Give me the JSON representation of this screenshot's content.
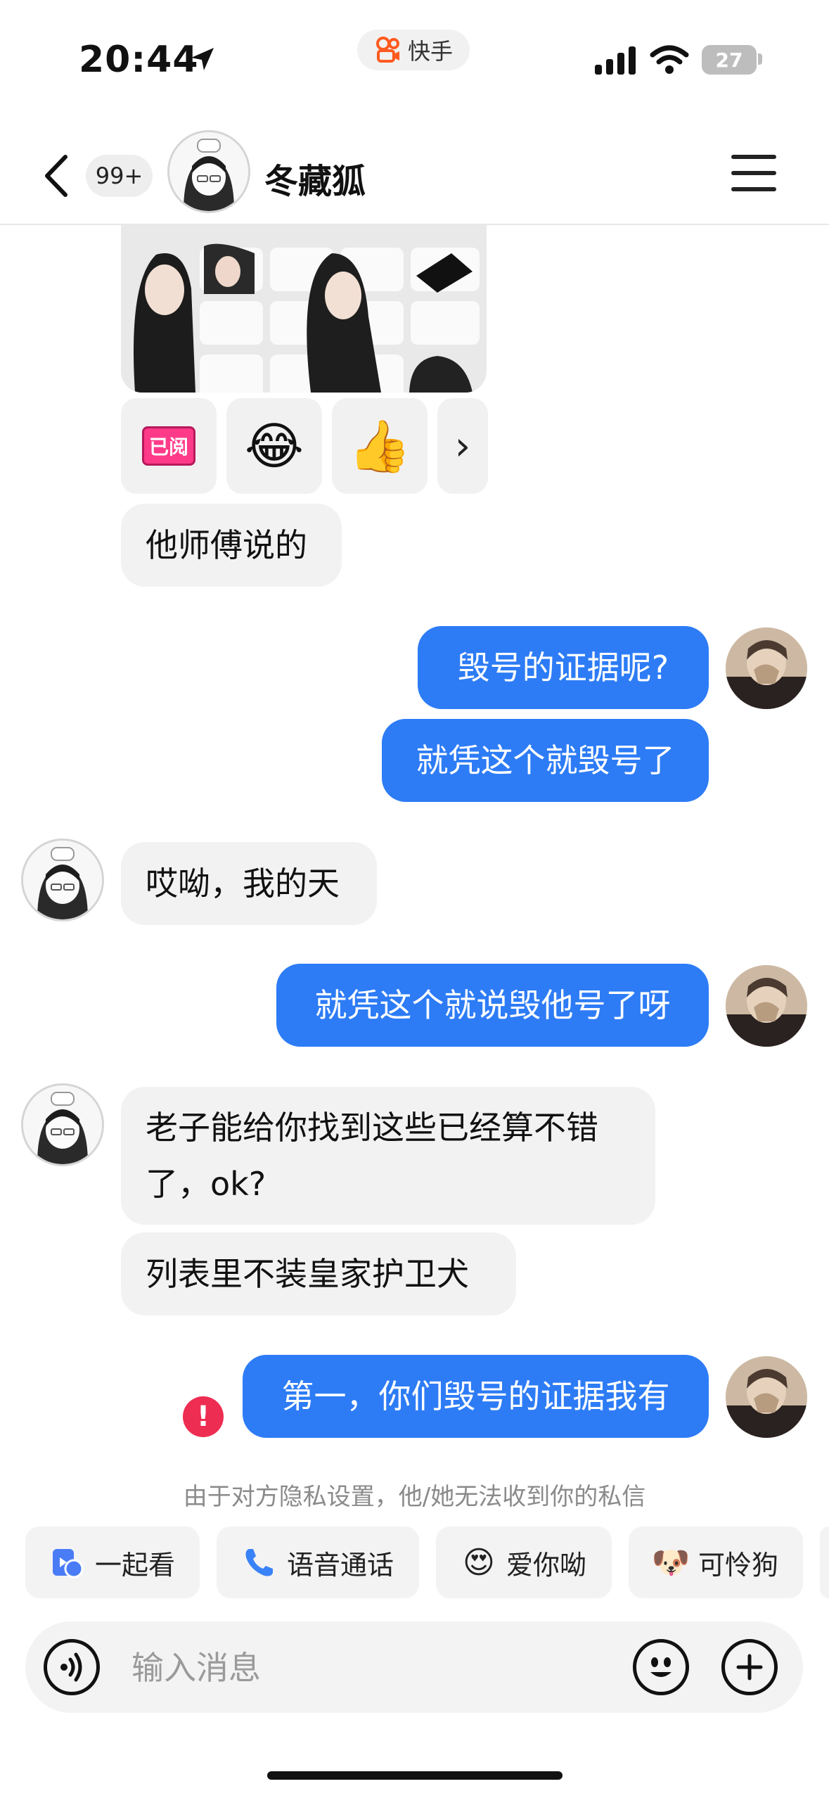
{
  "status_bar": {
    "time": "20:44",
    "app_pill": "快手",
    "battery": "27"
  },
  "header": {
    "unread_count": "99+",
    "contact_name": "冬藏狐",
    "icons": [
      "back-arrow-icon",
      "menu-icon"
    ]
  },
  "reactions": {
    "read_tag": "已阅",
    "emoji_1": "😂",
    "emoji_2": "👍",
    "more": "›"
  },
  "messages": [
    {
      "from": "friend",
      "text": "他师傅说的"
    },
    {
      "from": "me",
      "text": "毁号的证据呢?"
    },
    {
      "from": "me",
      "text": "就凭这个就毁号了"
    },
    {
      "from": "friend",
      "text": "哎呦，我的天"
    },
    {
      "from": "me",
      "text": "就凭这个就说毁他号了呀"
    },
    {
      "from": "friend",
      "text": "老子能给你找到这些已经算不错了，ok?"
    },
    {
      "from": "friend",
      "text": "列表里不装皇家护卫犬"
    },
    {
      "from": "me",
      "text": "第一，你们毁号的证据我有",
      "status": "failed"
    }
  ],
  "error_mark": "!",
  "privacy_note": "由于对方隐私设置，他/她无法收到你的私信",
  "quick_actions": [
    {
      "label": "一起看",
      "icon": "watch-together-icon"
    },
    {
      "label": "语音通话",
      "icon": "phone-icon"
    },
    {
      "label": "爱你呦",
      "icon": "heart-eyes-icon"
    },
    {
      "label": "可怜狗",
      "icon": "dog-face-icon"
    }
  ],
  "composer": {
    "placeholder": "输入消息"
  },
  "colors": {
    "outgoing_bubble": "#2d7cf6",
    "incoming_bubble": "#f2f2f2",
    "error": "#ee2d52",
    "read_tag": "#ff3a88"
  }
}
